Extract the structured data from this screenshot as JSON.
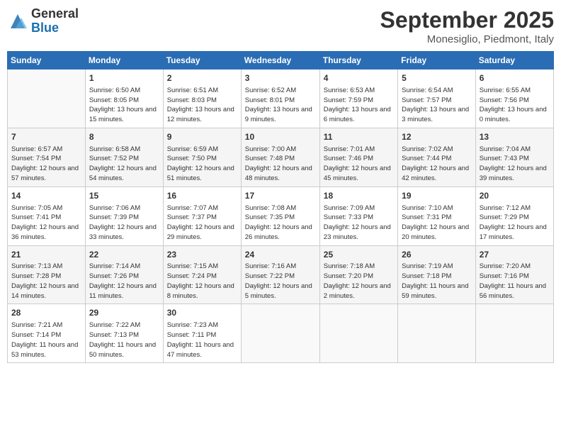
{
  "logo": {
    "general": "General",
    "blue": "Blue"
  },
  "title": "September 2025",
  "location": "Monesiglio, Piedmont, Italy",
  "weekdays": [
    "Sunday",
    "Monday",
    "Tuesday",
    "Wednesday",
    "Thursday",
    "Friday",
    "Saturday"
  ],
  "weeks": [
    [
      {
        "day": "",
        "sunrise": "",
        "sunset": "",
        "daylight": "",
        "empty": true
      },
      {
        "day": "1",
        "sunrise": "Sunrise: 6:50 AM",
        "sunset": "Sunset: 8:05 PM",
        "daylight": "Daylight: 13 hours and 15 minutes."
      },
      {
        "day": "2",
        "sunrise": "Sunrise: 6:51 AM",
        "sunset": "Sunset: 8:03 PM",
        "daylight": "Daylight: 13 hours and 12 minutes."
      },
      {
        "day": "3",
        "sunrise": "Sunrise: 6:52 AM",
        "sunset": "Sunset: 8:01 PM",
        "daylight": "Daylight: 13 hours and 9 minutes."
      },
      {
        "day": "4",
        "sunrise": "Sunrise: 6:53 AM",
        "sunset": "Sunset: 7:59 PM",
        "daylight": "Daylight: 13 hours and 6 minutes."
      },
      {
        "day": "5",
        "sunrise": "Sunrise: 6:54 AM",
        "sunset": "Sunset: 7:57 PM",
        "daylight": "Daylight: 13 hours and 3 minutes."
      },
      {
        "day": "6",
        "sunrise": "Sunrise: 6:55 AM",
        "sunset": "Sunset: 7:56 PM",
        "daylight": "Daylight: 13 hours and 0 minutes."
      }
    ],
    [
      {
        "day": "7",
        "sunrise": "Sunrise: 6:57 AM",
        "sunset": "Sunset: 7:54 PM",
        "daylight": "Daylight: 12 hours and 57 minutes."
      },
      {
        "day": "8",
        "sunrise": "Sunrise: 6:58 AM",
        "sunset": "Sunset: 7:52 PM",
        "daylight": "Daylight: 12 hours and 54 minutes."
      },
      {
        "day": "9",
        "sunrise": "Sunrise: 6:59 AM",
        "sunset": "Sunset: 7:50 PM",
        "daylight": "Daylight: 12 hours and 51 minutes."
      },
      {
        "day": "10",
        "sunrise": "Sunrise: 7:00 AM",
        "sunset": "Sunset: 7:48 PM",
        "daylight": "Daylight: 12 hours and 48 minutes."
      },
      {
        "day": "11",
        "sunrise": "Sunrise: 7:01 AM",
        "sunset": "Sunset: 7:46 PM",
        "daylight": "Daylight: 12 hours and 45 minutes."
      },
      {
        "day": "12",
        "sunrise": "Sunrise: 7:02 AM",
        "sunset": "Sunset: 7:44 PM",
        "daylight": "Daylight: 12 hours and 42 minutes."
      },
      {
        "day": "13",
        "sunrise": "Sunrise: 7:04 AM",
        "sunset": "Sunset: 7:43 PM",
        "daylight": "Daylight: 12 hours and 39 minutes."
      }
    ],
    [
      {
        "day": "14",
        "sunrise": "Sunrise: 7:05 AM",
        "sunset": "Sunset: 7:41 PM",
        "daylight": "Daylight: 12 hours and 36 minutes."
      },
      {
        "day": "15",
        "sunrise": "Sunrise: 7:06 AM",
        "sunset": "Sunset: 7:39 PM",
        "daylight": "Daylight: 12 hours and 33 minutes."
      },
      {
        "day": "16",
        "sunrise": "Sunrise: 7:07 AM",
        "sunset": "Sunset: 7:37 PM",
        "daylight": "Daylight: 12 hours and 29 minutes."
      },
      {
        "day": "17",
        "sunrise": "Sunrise: 7:08 AM",
        "sunset": "Sunset: 7:35 PM",
        "daylight": "Daylight: 12 hours and 26 minutes."
      },
      {
        "day": "18",
        "sunrise": "Sunrise: 7:09 AM",
        "sunset": "Sunset: 7:33 PM",
        "daylight": "Daylight: 12 hours and 23 minutes."
      },
      {
        "day": "19",
        "sunrise": "Sunrise: 7:10 AM",
        "sunset": "Sunset: 7:31 PM",
        "daylight": "Daylight: 12 hours and 20 minutes."
      },
      {
        "day": "20",
        "sunrise": "Sunrise: 7:12 AM",
        "sunset": "Sunset: 7:29 PM",
        "daylight": "Daylight: 12 hours and 17 minutes."
      }
    ],
    [
      {
        "day": "21",
        "sunrise": "Sunrise: 7:13 AM",
        "sunset": "Sunset: 7:28 PM",
        "daylight": "Daylight: 12 hours and 14 minutes."
      },
      {
        "day": "22",
        "sunrise": "Sunrise: 7:14 AM",
        "sunset": "Sunset: 7:26 PM",
        "daylight": "Daylight: 12 hours and 11 minutes."
      },
      {
        "day": "23",
        "sunrise": "Sunrise: 7:15 AM",
        "sunset": "Sunset: 7:24 PM",
        "daylight": "Daylight: 12 hours and 8 minutes."
      },
      {
        "day": "24",
        "sunrise": "Sunrise: 7:16 AM",
        "sunset": "Sunset: 7:22 PM",
        "daylight": "Daylight: 12 hours and 5 minutes."
      },
      {
        "day": "25",
        "sunrise": "Sunrise: 7:18 AM",
        "sunset": "Sunset: 7:20 PM",
        "daylight": "Daylight: 12 hours and 2 minutes."
      },
      {
        "day": "26",
        "sunrise": "Sunrise: 7:19 AM",
        "sunset": "Sunset: 7:18 PM",
        "daylight": "Daylight: 11 hours and 59 minutes."
      },
      {
        "day": "27",
        "sunrise": "Sunrise: 7:20 AM",
        "sunset": "Sunset: 7:16 PM",
        "daylight": "Daylight: 11 hours and 56 minutes."
      }
    ],
    [
      {
        "day": "28",
        "sunrise": "Sunrise: 7:21 AM",
        "sunset": "Sunset: 7:14 PM",
        "daylight": "Daylight: 11 hours and 53 minutes."
      },
      {
        "day": "29",
        "sunrise": "Sunrise: 7:22 AM",
        "sunset": "Sunset: 7:13 PM",
        "daylight": "Daylight: 11 hours and 50 minutes."
      },
      {
        "day": "30",
        "sunrise": "Sunrise: 7:23 AM",
        "sunset": "Sunset: 7:11 PM",
        "daylight": "Daylight: 11 hours and 47 minutes."
      },
      {
        "day": "",
        "sunrise": "",
        "sunset": "",
        "daylight": "",
        "empty": true
      },
      {
        "day": "",
        "sunrise": "",
        "sunset": "",
        "daylight": "",
        "empty": true
      },
      {
        "day": "",
        "sunrise": "",
        "sunset": "",
        "daylight": "",
        "empty": true
      },
      {
        "day": "",
        "sunrise": "",
        "sunset": "",
        "daylight": "",
        "empty": true
      }
    ]
  ]
}
